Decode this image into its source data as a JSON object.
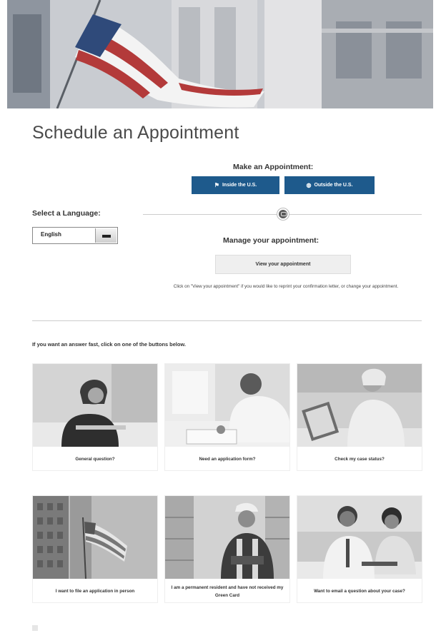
{
  "page": {
    "title": "Schedule an Appointment"
  },
  "appointment": {
    "make_label": "Make an Appointment:",
    "inside_label": "Inside the U.S.",
    "outside_label": "Outside the U.S.",
    "inside_icon": "flag-icon",
    "outside_icon": "globe-icon"
  },
  "language": {
    "label": "Select a Language:",
    "selected": "English"
  },
  "manage": {
    "icon": "calendar-icon",
    "label": "Manage your appointment:",
    "view_button": "View your appointment",
    "help_text": "Click on \"View your appointment\" if you would like to reprint your confirmation letter, or change your appointment."
  },
  "quick_help": {
    "intro": "If you want an answer fast, click on one of the buttons below.",
    "cards": [
      {
        "label": "General question?"
      },
      {
        "label": "Need an application form?"
      },
      {
        "label": "Check my case status?"
      },
      {
        "label": "I want to file an application in person"
      },
      {
        "label": "I am a permanent resident and have not received my Green Card"
      },
      {
        "label": "Want to email a question about your case?"
      }
    ]
  },
  "colors": {
    "accent": "#1e5a8c",
    "title": "#4a4a4a"
  }
}
